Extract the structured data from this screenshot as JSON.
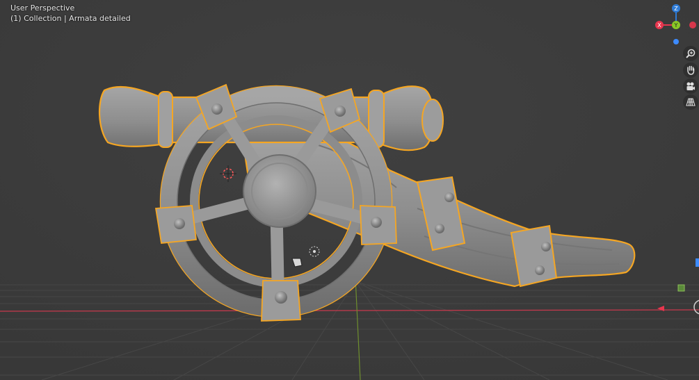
{
  "viewport": {
    "view_label": "User Perspective",
    "collection_label": "(1) Collection | Armata detailed",
    "object_name": "Armata detailed"
  },
  "gizmo": {
    "x_label": "X",
    "y_label": "Y",
    "z_label": "Z",
    "colors": {
      "x": "#e8364e",
      "y": "#8ac926",
      "z": "#2e7bd6"
    }
  },
  "navigation": [
    {
      "name": "zoom-icon"
    },
    {
      "name": "pan-hand-icon"
    },
    {
      "name": "camera-view-icon"
    },
    {
      "name": "ortho-grid-icon"
    }
  ],
  "colors": {
    "background": "#3d3d3d",
    "selection_outline": "#f5a623",
    "model": "#8f8f8f",
    "x_axis_line": "#c8394d",
    "y_axis_line": "#6f8f2e"
  }
}
